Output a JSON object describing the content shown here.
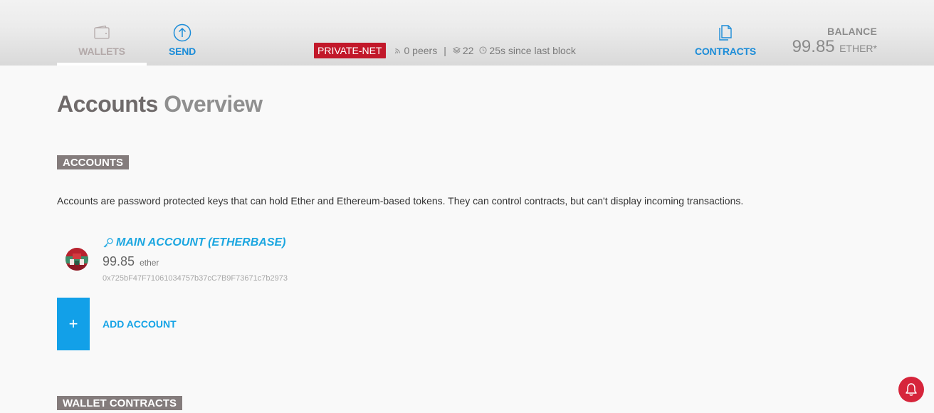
{
  "nav": {
    "wallets_label": "WALLETS",
    "send_label": "SEND",
    "contracts_label": "CONTRACTS"
  },
  "status": {
    "network": "PRIVATE-NET",
    "peers": "0 peers",
    "separator": "|",
    "blocks": "22",
    "last_block": "25s since last block"
  },
  "balance": {
    "label": "BALANCE",
    "value": "99.85",
    "unit": "ETHER*"
  },
  "page": {
    "title_strong": "Accounts",
    "title_light": "Overview"
  },
  "accounts_section": {
    "tag": "ACCOUNTS",
    "description": "Accounts are password protected keys that can hold Ether and Ethereum-based tokens. They can control contracts, but can't display incoming transactions."
  },
  "account": {
    "name": "MAIN ACCOUNT (ETHERBASE)",
    "balance": "99.85",
    "unit": "ether",
    "address": "0x725bF47F71061034757b37cC7B9F73671c7b2973"
  },
  "add_account": {
    "plus": "+",
    "label": "ADD ACCOUNT"
  },
  "wallets_section": {
    "tag": "WALLET CONTRACTS"
  },
  "colors": {
    "accent_blue": "#1b8cd8",
    "network_red": "#c2182a",
    "tag_gray": "#847c7c",
    "add_blue": "#12a0e8"
  },
  "icons": [
    "wallet-icon",
    "send-icon",
    "contracts-icon",
    "peers-icon",
    "blocks-icon",
    "clock-icon",
    "key-icon",
    "bell-icon"
  ]
}
